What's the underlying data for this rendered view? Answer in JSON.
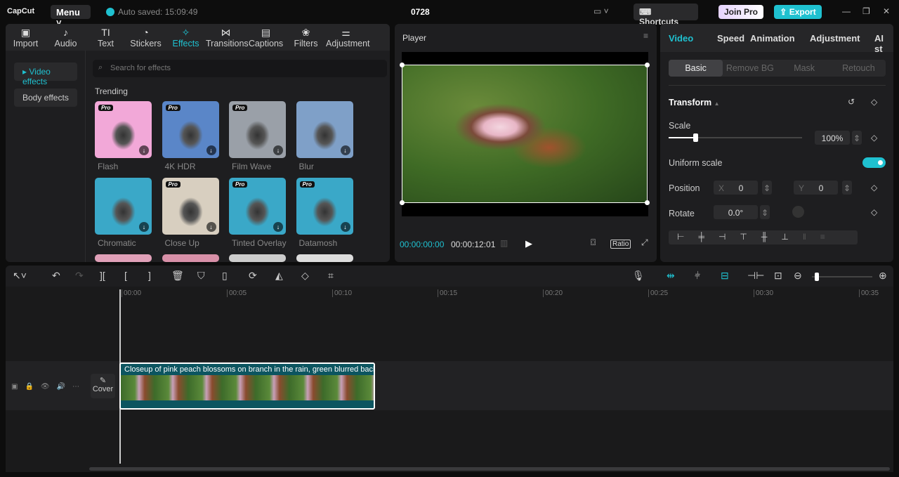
{
  "app": {
    "logo": "CapCut",
    "menu": "Menu",
    "autosave": "Auto saved: 15:09:49",
    "title": "0728",
    "shortcuts": "Shortcuts",
    "join_pro": "Join Pro",
    "export": "Export"
  },
  "left_tabs": [
    {
      "label": "Import",
      "icon": "▣"
    },
    {
      "label": "Audio",
      "icon": "♪"
    },
    {
      "label": "Text",
      "icon": "TI"
    },
    {
      "label": "Stickers",
      "icon": "◔"
    },
    {
      "label": "Effects",
      "icon": "✧"
    },
    {
      "label": "Transitions",
      "icon": "⋈"
    },
    {
      "label": "Captions",
      "icon": "▤"
    },
    {
      "label": "Filters",
      "icon": "❀"
    },
    {
      "label": "Adjustment",
      "icon": "⚌"
    }
  ],
  "effects_side": [
    "Video effects",
    "Body effects"
  ],
  "search_placeholder": "Search for effects",
  "section": "Trending",
  "effects": [
    {
      "name": "Flash",
      "pro": true,
      "color": "#f2a8d8"
    },
    {
      "name": "4K HDR",
      "pro": true,
      "color": "#5a86c8"
    },
    {
      "name": "Film Wave",
      "pro": true,
      "color": "#9aa0a8"
    },
    {
      "name": "Blur",
      "pro": false,
      "color": "#7fa0c8"
    },
    {
      "name": "Chromatic",
      "pro": false,
      "color": "#3aa8c8"
    },
    {
      "name": "Close Up",
      "pro": true,
      "color": "#d8cfc0"
    },
    {
      "name": "Tinted Overlay",
      "pro": true,
      "color": "#3aa8c8"
    },
    {
      "name": "Datamosh",
      "pro": true,
      "color": "#3aa8c8"
    }
  ],
  "pro_badge": "Pro",
  "player": {
    "title": "Player",
    "current": "00:00:00:00",
    "total": "00:00:12:01",
    "ratio": "Ratio"
  },
  "right": {
    "tabs": [
      "Video",
      "Speed",
      "Animation",
      "Adjustment",
      "AI st"
    ],
    "subtabs": [
      "Basic",
      "Remove BG",
      "Mask",
      "Retouch"
    ],
    "section": "Transform",
    "scale_label": "Scale",
    "scale_value": "100%",
    "scale_fraction": 0.2,
    "uniform": "Uniform scale",
    "uniform_on": true,
    "position": "Position",
    "x_label": "X",
    "x": "0",
    "y_label": "Y",
    "y": "0",
    "rotate": "Rotate",
    "rotate_value": "0.0°"
  },
  "timeline": {
    "ticks": [
      "00:00",
      "00:05",
      "00:10",
      "00:15",
      "00:20",
      "00:25",
      "00:30",
      "00:35"
    ],
    "clip_title": "Closeup of pink peach blossoms on branch in the rain, green blurred background",
    "cover": "Cover"
  }
}
